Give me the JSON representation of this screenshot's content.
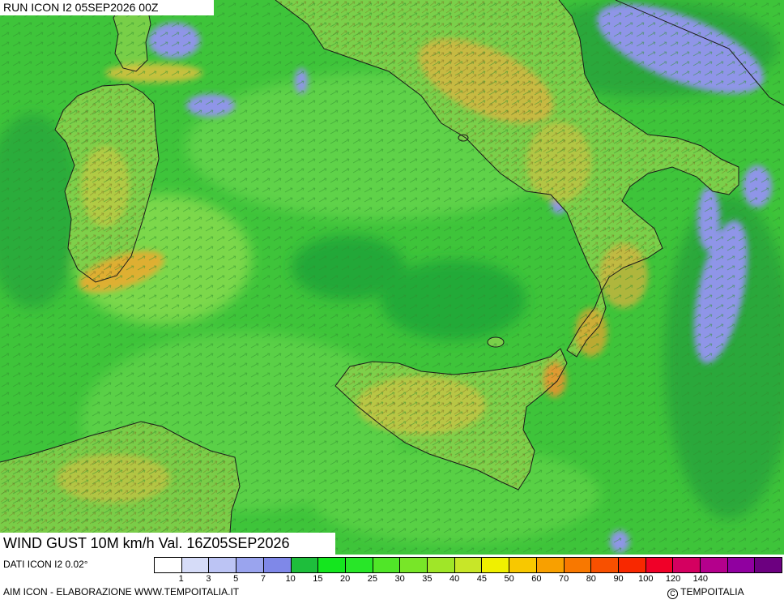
{
  "header": {
    "run_label": "RUN ICON I2 05SEP2026 00Z"
  },
  "map": {
    "title": "WIND GUST 10M km/h Val. 16Z05SEP2026",
    "field": "wind gust 10m",
    "colors": {
      "sea_base": "#3ec43a",
      "land_base": "#6fd24a",
      "calm": "#8f95e8",
      "strong": "#f0a830",
      "coast": "#1a1a1a",
      "arrow": "#2a7a2a"
    }
  },
  "footer": {
    "dati": "DATI ICON I2 0.02°",
    "credit": "AIM ICON - ELABORAZIONE WWW.TEMPOITALIA.IT",
    "copyright": "TEMPOITALIA",
    "copyright_symbol": "C"
  },
  "legend": {
    "colors": [
      "#ffffff",
      "#d6dcf8",
      "#bcc4f4",
      "#9aa4ee",
      "#7f88e8",
      "#1ebe3c",
      "#14e61e",
      "#28e628",
      "#50e628",
      "#78e628",
      "#a0e628",
      "#c8e628",
      "#f0f000",
      "#f8c800",
      "#f8a000",
      "#f87800",
      "#f85000",
      "#f82800",
      "#f00028",
      "#d40060",
      "#b4008c",
      "#9000a0",
      "#6c0080"
    ],
    "tick_labels": [
      "1",
      "3",
      "5",
      "7",
      "10",
      "15",
      "20",
      "25",
      "30",
      "35",
      "40",
      "45",
      "50",
      "60",
      "70",
      "80",
      "90",
      "100",
      "120",
      "140"
    ]
  }
}
